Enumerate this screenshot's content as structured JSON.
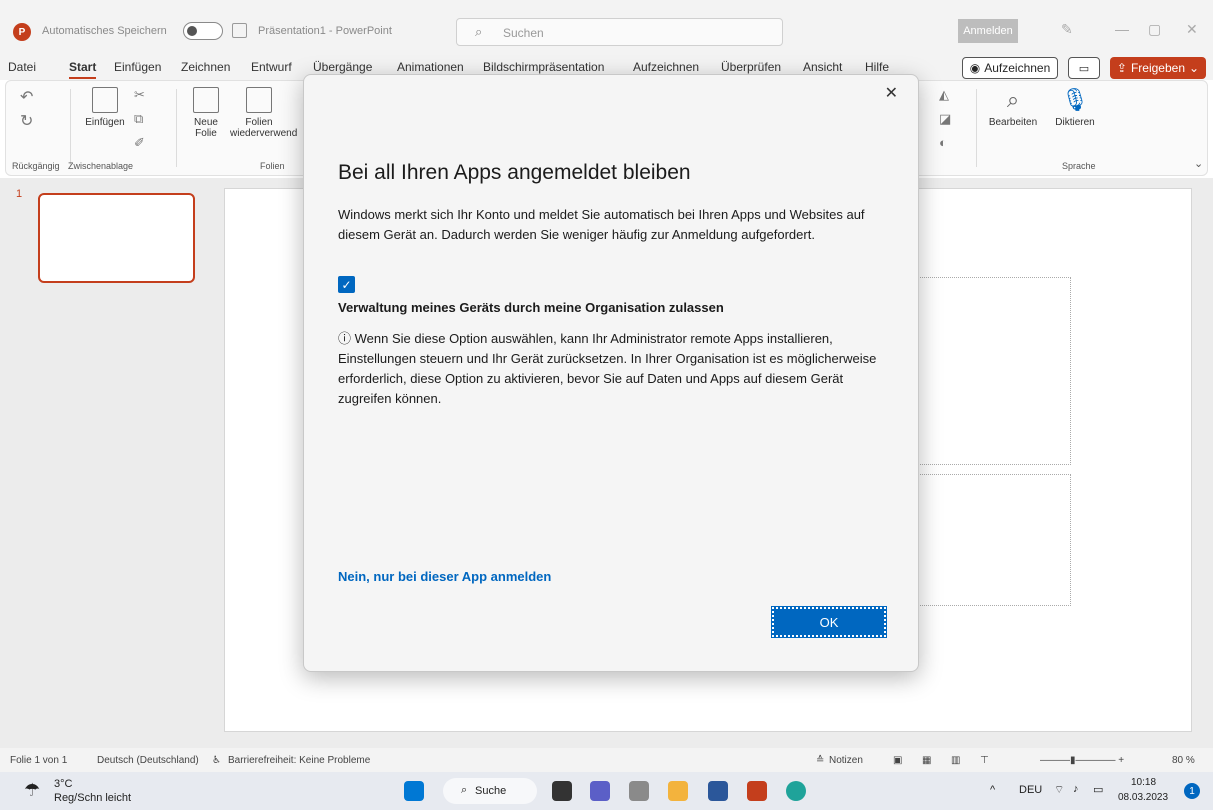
{
  "titlebar": {
    "autosave_label": "Automatisches Speichern",
    "doc_title": "Präsentation1 - PowerPoint",
    "search_placeholder": "Suchen",
    "signin_label": "Anmelden",
    "app_logo": "P"
  },
  "menu": {
    "tabs": [
      "Datei",
      "Start",
      "Einfügen",
      "Zeichnen",
      "Entwurf",
      "Übergänge",
      "Animationen",
      "Bildschirmpräsentation",
      "Aufzeichnen",
      "Überprüfen",
      "Ansicht",
      "Hilfe"
    ],
    "active_tab": "Start",
    "record_label": "Aufzeichnen",
    "share_label": "Freigeben"
  },
  "ribbon": {
    "undo_group": "Rückgängig",
    "paste_label": "Einfügen",
    "clipboard_group": "Zwischenablage",
    "new_slide_label": "Neue",
    "new_slide_label2": "Folie",
    "reuse_label": "Folien",
    "reuse_label2": "wiederverwend",
    "slides_group": "Folien",
    "edit_label": "Bearbeiten",
    "dictate_label": "Diktieren",
    "language_group": "Sprache"
  },
  "slides": {
    "thumb_number": "1"
  },
  "dialog": {
    "title": "Bei all Ihren Apps angemeldet bleiben",
    "description": "Windows merkt sich Ihr Konto und meldet Sie automatisch bei Ihren Apps und Websites auf diesem Gerät an. Dadurch werden Sie weniger häufig zur Anmeldung aufgefordert.",
    "checkbox_checked": true,
    "checkbox_label": "Verwaltung meines Geräts durch meine Organisation zulassen",
    "info_text": "Wenn Sie diese Option auswählen, kann Ihr Administrator remote Apps installieren, Einstellungen steuern und Ihr Gerät zurücksetzen. In Ihrer Organisation ist es möglicherweise erforderlich, diese Option zu aktivieren, bevor Sie auf Daten und Apps auf diesem Gerät zugreifen können.",
    "link_label": "Nein, nur bei dieser App anmelden",
    "ok_label": "OK"
  },
  "statusbar": {
    "slide_info": "Folie 1 von 1",
    "language": "Deutsch (Deutschland)",
    "accessibility": "Barrierefreiheit: Keine Probleme",
    "notes_label": "Notizen",
    "zoom": "80 %"
  },
  "taskbar": {
    "weather_temp": "3°C",
    "weather_desc": "Reg/Schn leicht",
    "search_label": "Suche",
    "lang": "DEU",
    "time": "10:18",
    "date": "08.03.2023",
    "notification_count": "1"
  },
  "colors": {
    "accent": "#c43e1c",
    "dialog_blue": "#0067c0"
  }
}
